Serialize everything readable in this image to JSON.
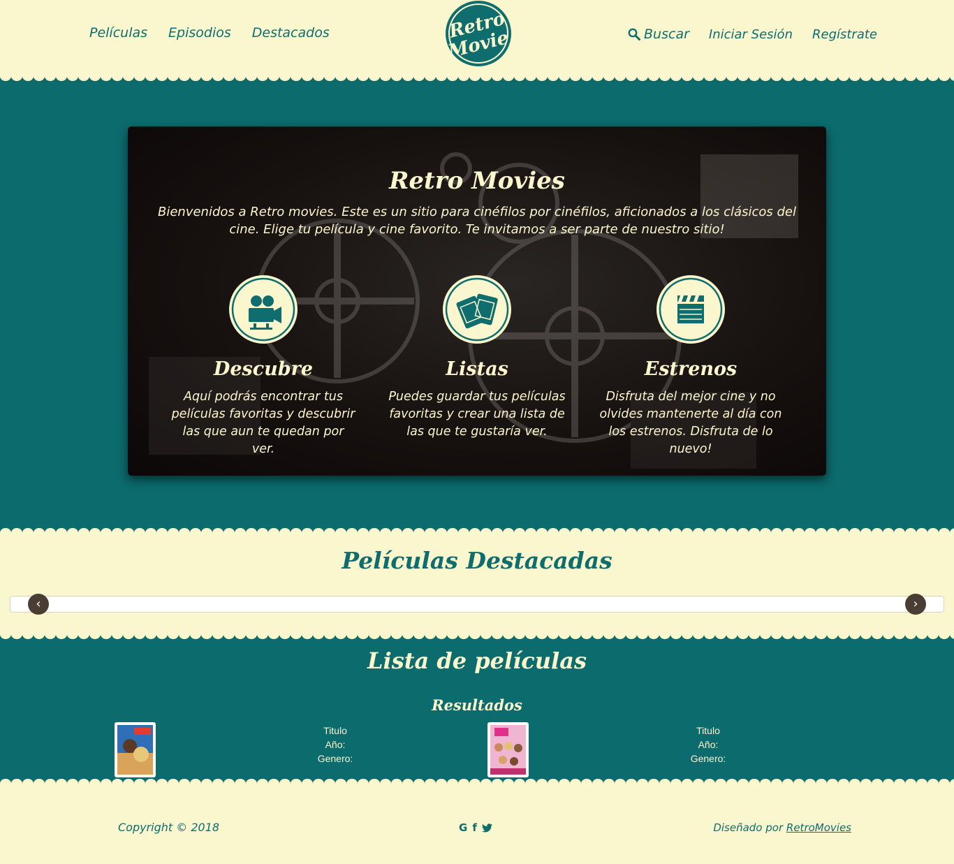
{
  "nav": {
    "left": [
      "Películas",
      "Episodios",
      "Destacados"
    ],
    "search": "Buscar",
    "login": "Iniciar Sesión",
    "register": "Regístrate"
  },
  "logo": {
    "line1": "Retro",
    "line2": "Movie"
  },
  "hero": {
    "title": "Retro Movies",
    "intro": "Bienvenidos a Retro movies. Este es un sitio para cinéfilos por cinéfilos, aficionados a los clásicos del cine. Elige tu película y cine favorito. Te invitamos a ser parte de nuestro sitio!",
    "features": [
      {
        "icon": "movie-camera-icon",
        "title": "Descubre",
        "text": "Aquí podrás encontrar tus películas favoritas y descubrir las que aun te quedan por ver."
      },
      {
        "icon": "ticket-icon",
        "title": "Listas",
        "text": "Puedes guardar tus películas favoritas y crear una lista de las que te gustaría ver."
      },
      {
        "icon": "clapperboard-icon",
        "title": "Estrenos",
        "text": "Disfruta del mejor cine y no olvides mantenerte al día con los estrenos. Disfruta de lo nuevo!"
      }
    ]
  },
  "featured": {
    "title": "Películas Destacadas",
    "prev": "‹",
    "next": "›"
  },
  "list": {
    "title": "Lista de películas",
    "subtitle": "Resultados",
    "items": [
      {
        "titulo": "Titulo",
        "anio": "Año:",
        "genero": "Genero:"
      },
      {
        "titulo": "Titulo",
        "anio": "Año:",
        "genero": "Genero:"
      }
    ]
  },
  "footer": {
    "copyright": "Copyright © 2018",
    "social": [
      "G",
      "f",
      "🐦"
    ],
    "credit_prefix": "Diseñado por ",
    "credit_link": "RetroMovies"
  },
  "colors": {
    "teal": "#0b6b6d",
    "cream": "#faf7cf",
    "dark": "#4a3d34"
  }
}
